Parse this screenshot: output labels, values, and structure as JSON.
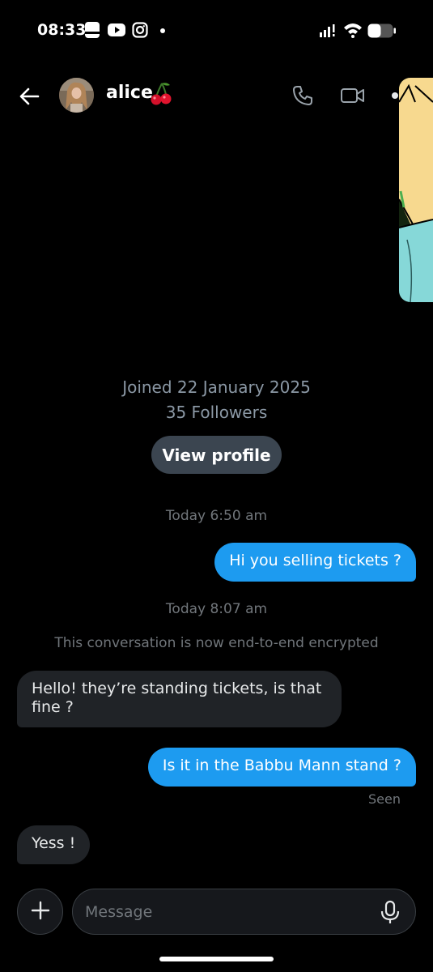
{
  "status_bar": {
    "time": "08:33",
    "left_icons": [
      "notes-icon",
      "youtube-icon",
      "instagram-icon"
    ],
    "right_icons": [
      "signal-icon",
      "wifi-icon",
      "battery-icon"
    ],
    "battery_level": 0.5
  },
  "header": {
    "contact_name": "alice",
    "name_emoji": "cherry-emoji"
  },
  "profile": {
    "joined": "Joined 22 January 2025",
    "followers": "35 Followers",
    "view_profile_label": "View profile"
  },
  "messages": [
    {
      "type": "timestamp",
      "text": "Today 6:50 am"
    },
    {
      "type": "sent",
      "text": "Hi you selling tickets ?"
    },
    {
      "type": "timestamp",
      "text": "Today 8:07 am"
    },
    {
      "type": "system",
      "text": "This conversation is now end-to-end encrypted"
    },
    {
      "type": "received",
      "text": "Hello! they’re standing tickets, is that fine ?"
    },
    {
      "type": "sent",
      "text": "Is it in the Babbu Mann stand ?"
    },
    {
      "type": "received",
      "text": "Yess !"
    }
  ],
  "seen_label": "Seen",
  "composer": {
    "placeholder": "Message"
  },
  "colors": {
    "background": "#000000",
    "sent_bubble": "#1d9bf0",
    "received_bubble": "#202327",
    "muted_text": "#71767b",
    "view_profile_button": "#3b4550"
  }
}
